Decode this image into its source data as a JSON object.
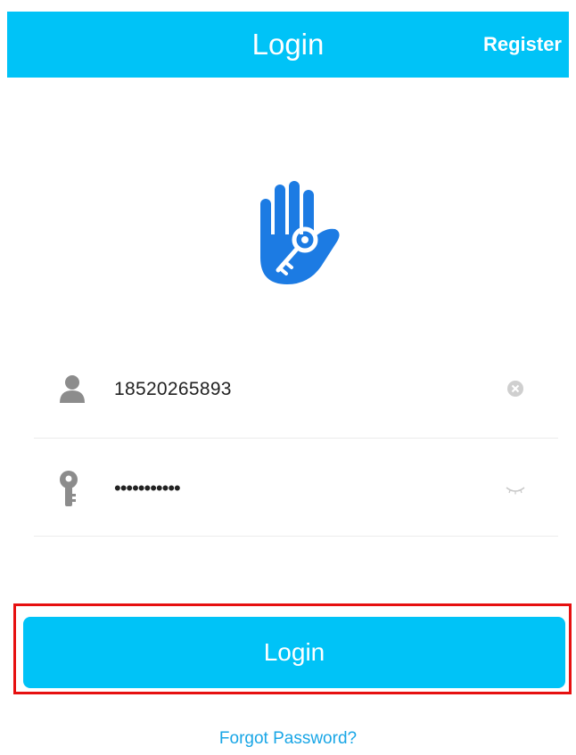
{
  "header": {
    "title": "Login",
    "register_label": "Register"
  },
  "logo": {
    "icon": "hand-key-icon"
  },
  "form": {
    "username": {
      "icon": "user-icon",
      "value": "18520265893",
      "clear_icon": "clear-icon"
    },
    "password": {
      "icon": "key-icon",
      "masked_value": "•••••••••••",
      "toggle_icon": "eye-closed-icon"
    }
  },
  "login_button": {
    "label": "Login"
  },
  "forgot_password": {
    "label": "Forgot Password?"
  },
  "colors": {
    "primary": "#00c3f7",
    "logo": "#1c7be3",
    "link": "#19a6e6",
    "highlight": "#e61010",
    "icon_gray": "#8c8c8c"
  }
}
